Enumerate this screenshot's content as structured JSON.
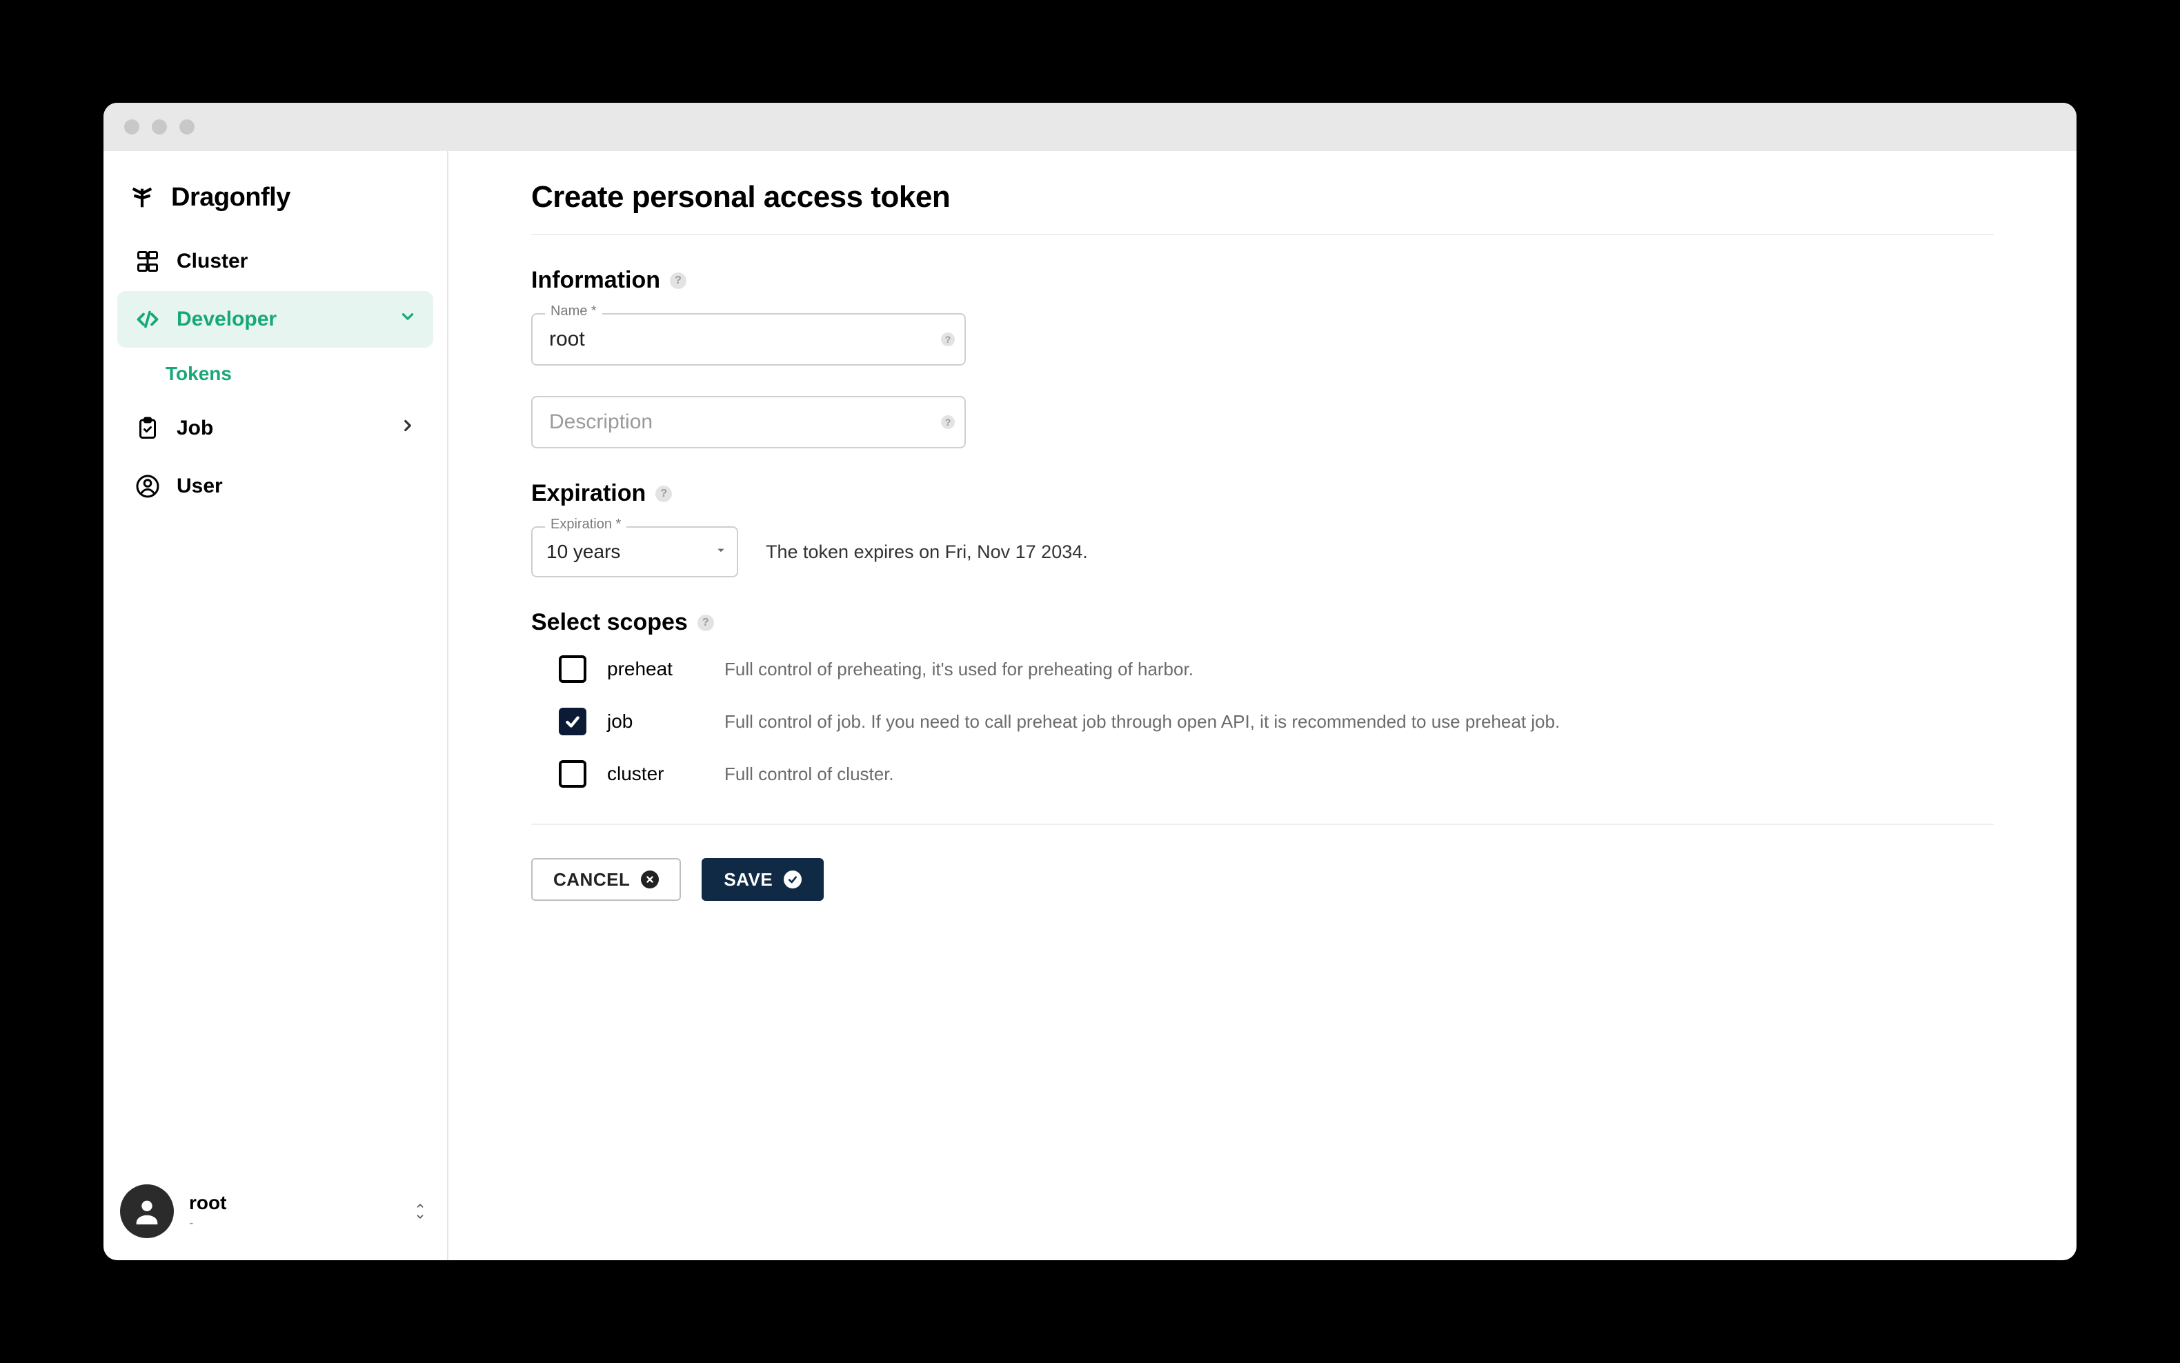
{
  "brand": {
    "name": "Dragonfly"
  },
  "sidebar": {
    "items": [
      {
        "label": "Cluster"
      },
      {
        "label": "Developer"
      },
      {
        "label": "Job"
      },
      {
        "label": "User"
      }
    ],
    "sub": {
      "tokens": "Tokens"
    }
  },
  "user": {
    "name": "root",
    "sub": "-"
  },
  "page": {
    "title": "Create personal access token"
  },
  "sections": {
    "information": "Information",
    "expiration": "Expiration",
    "scopes": "Select scopes"
  },
  "form": {
    "name_label": "Name *",
    "name_value": "root",
    "description_placeholder": "Description",
    "expiration_label": "Expiration *",
    "expiration_value": "10 years",
    "expiration_text": "The token expires on Fri, Nov 17 2034."
  },
  "scopes": [
    {
      "key": "preheat",
      "label": "preheat",
      "checked": false,
      "desc": "Full control of preheating, it's used for preheating of harbor."
    },
    {
      "key": "job",
      "label": "job",
      "checked": true,
      "desc": "Full control of job. If you need to call preheat job through open API, it is recommended to use preheat job."
    },
    {
      "key": "cluster",
      "label": "cluster",
      "checked": false,
      "desc": "Full control of cluster."
    }
  ],
  "actions": {
    "cancel": "CANCEL",
    "save": "SAVE"
  }
}
